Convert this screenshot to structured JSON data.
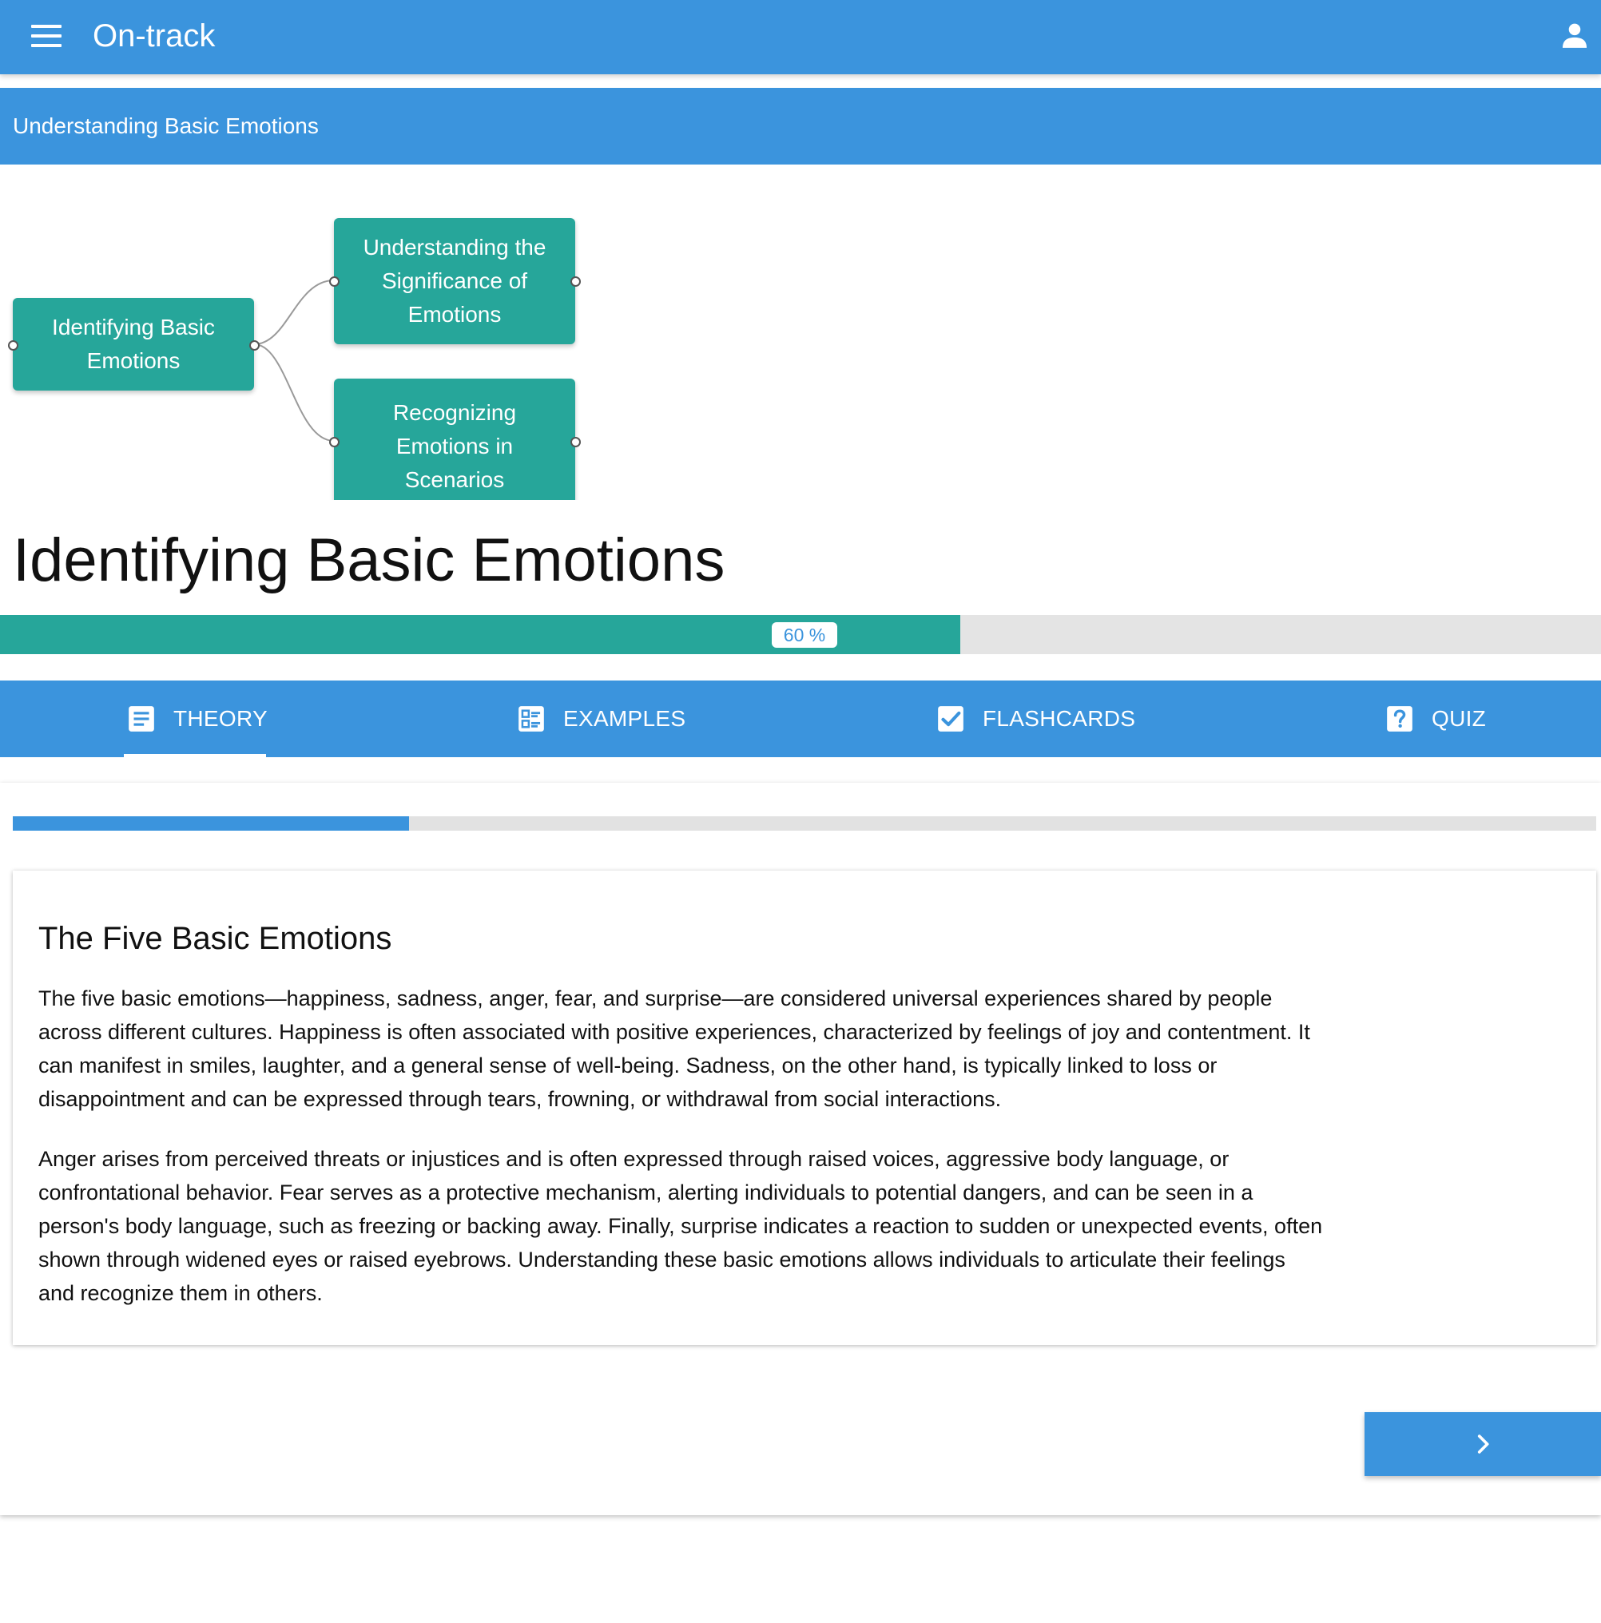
{
  "app": {
    "title": "On-track",
    "colors": {
      "primary": "#3b94dd",
      "accent": "#26a69a",
      "track": "#e4e4e4"
    }
  },
  "header": {
    "menu_icon": "menu-icon",
    "user_icon": "account-icon"
  },
  "subheader": {
    "title": "Understanding Basic Emotions"
  },
  "mindmap": {
    "root": {
      "label": "Identifying Basic Emotions"
    },
    "children": [
      {
        "label": "Understanding the Significance of Emotions"
      },
      {
        "label": "Recognizing Emotions in Scenarios"
      }
    ]
  },
  "topic": {
    "title": "Identifying Basic Emotions",
    "progress_label": "60 %",
    "progress_fraction": 0.6
  },
  "tabs": [
    {
      "label": "THEORY",
      "icon": "article-icon",
      "active": true
    },
    {
      "label": "EXAMPLES",
      "icon": "dashboard-list-icon",
      "active": false
    },
    {
      "label": "FLASHCARDS",
      "icon": "check-box-icon",
      "active": false
    },
    {
      "label": "QUIZ",
      "icon": "help-box-icon",
      "active": false
    }
  ],
  "theory": {
    "section_progress_fraction": 0.25,
    "heading": "The Five Basic Emotions",
    "paragraphs": [
      "The five basic emotions—happiness, sadness, anger, fear, and surprise—are considered universal experiences shared by people across different cultures. Happiness is often associated with positive experiences, characterized by feelings of joy and contentment. It can manifest in smiles, laughter, and a general sense of well-being. Sadness, on the other hand, is typically linked to loss or disappointment and can be expressed through tears, frowning, or withdrawal from social interactions.",
      "Anger arises from perceived threats or injustices and is often expressed through raised voices, aggressive body language, or confrontational behavior. Fear serves as a protective mechanism, alerting individuals to potential dangers, and can be seen in a person's body language, such as freezing or backing away. Finally, surprise indicates a reaction to sudden or unexpected events, often shown through widened eyes or raised eyebrows. Understanding these basic emotions allows individuals to articulate their feelings and recognize them in others."
    ],
    "next_icon": "chevron-right-icon"
  }
}
